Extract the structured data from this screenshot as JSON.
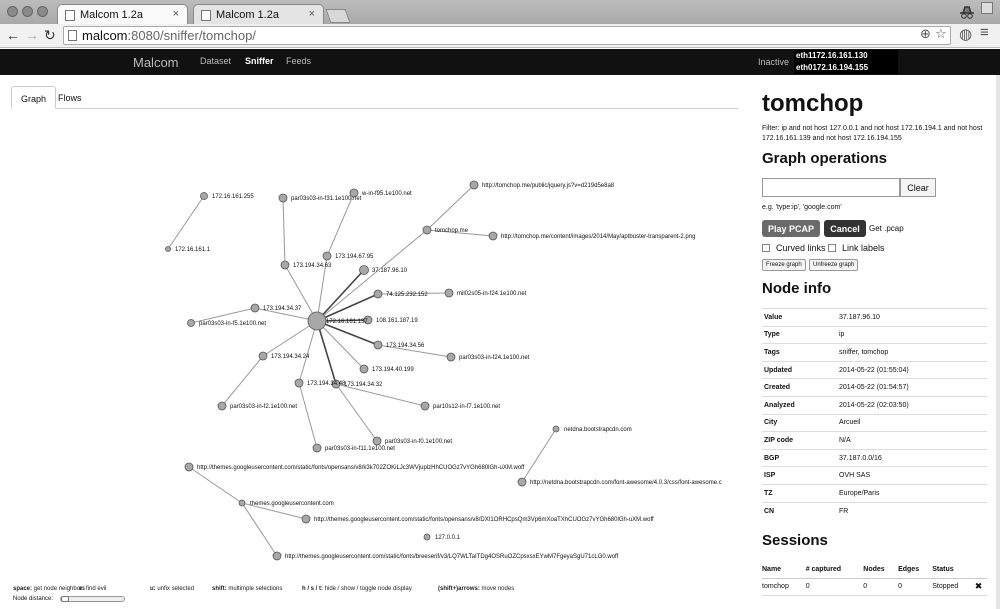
{
  "browser": {
    "tabs": [
      {
        "title": "Malcom 1.2a",
        "close": "×"
      },
      {
        "title": "Malcom 1.2a",
        "close": "×"
      }
    ],
    "url_host": "malcom",
    "url_rest": ":8080/sniffer/tomchop/",
    "icons": {
      "back": "←",
      "forward": "→",
      "reload": "↻",
      "zoom": "⊕",
      "star": "☆",
      "globe": "◍",
      "menu": "≡"
    }
  },
  "app": {
    "brand": "Malcom",
    "nav": [
      "Dataset",
      "Sniffer",
      "Feeds"
    ],
    "status": "Inactive",
    "interfaces": [
      "eth1172.16.161.130",
      "eth0172.16.194.155"
    ]
  },
  "left_tabs": [
    "Graph",
    "Flows"
  ],
  "graph": {
    "hub": "172.16.161.137",
    "nodes": [
      "172.16.161.255",
      "172.16.161.1",
      "par03s03-in-f31.1e100.net",
      "w-in-f95.1e100.net",
      "http://tomchop.me/public/jquery.js?v=d219d5e8a8",
      "tomchop.me",
      "http://tomchop.me/content/images/2014/May/aptbuster-transparent-2.png",
      "173.194.67.95",
      "173.194.34.63",
      "37.187.96.10",
      "74.125.232.152",
      "mil02s05-in-f24.1e100.net",
      "108.161.187.19",
      "173.194.34.37",
      "par03s03-in-f5.1e100.net",
      "173.194.34.56",
      "173.194.34.24",
      "par03s03-in-f24.1e100.net",
      "173.194.40.199",
      "173.194.34.48",
      "173.194.34.32",
      "par03s03-in-f2.1e100.net",
      "par10s12-in-f7.1e100.net",
      "par03s03-in-f0.1e100.net",
      "par03s03-in-f11.1e100.net",
      "netdna.bootstrapcdn.com",
      "http://themes.googleusercontent.com/static/fonts/opensans/v8/k3k702ZOKiLJc3WVjuplzHhCUOGz7vYGh680lGh-uXM.woff",
      "http://netdna.bootstrapcdn.com/font-awesome/4.0.3/css/font-awesome.c",
      "themes.googleusercontent.com",
      "http://themes.googleusercontent.com/static/fonts/opensans/v8/DXI1ORHCpsQm3Vp6mXoaTXhCUOGz7vYGh680lGh-uXM.woff",
      "127.0.0.1",
      "http://themes.googleusercontent.com/static/fonts/breeserif/v3/LQ7WLTaITDg4OSRuOZCpsxsxEYwM7FgeyaSgU71cLG0.woff"
    ]
  },
  "help": {
    "items": [
      {
        "key": "space:",
        "desc": " get node neighbors"
      },
      {
        "key": "e:",
        "desc": " find evil"
      },
      {
        "key": "u:",
        "desc": " unfix selected"
      },
      {
        "key": "shift:",
        "desc": " multimple selections"
      },
      {
        "key": "h / s / t:",
        "desc": " hide / show / toggle node display"
      },
      {
        "key": "(shift+)arrows:",
        "desc": " move nodes"
      }
    ],
    "node_distance": "Node distance:"
  },
  "panel": {
    "title": "tomchop",
    "filter": "Filter: ip and not host 127.0.0.1 and not host 172.16.194.1 and not host 172.16.161.139 and not host 172.16.194.155",
    "graph_ops_title": "Graph operations",
    "search_placeholder": "",
    "clear_label": "Clear",
    "hint": "e.g. 'type:ip', 'google.com'",
    "play_label": "Play PCAP",
    "cancel_label": "Cancel",
    "get_pcap": "Get .pcap",
    "curved_links": "Curved links",
    "link_labels": "Link labels",
    "freeze_label": "Freeze graph",
    "unfreeze_label": "Unfreeze graph",
    "node_info_title": "Node info",
    "node_info": [
      {
        "k": "Value",
        "v": "37.187.96.10"
      },
      {
        "k": "Type",
        "v": "ip"
      },
      {
        "k": "Tags",
        "v": "sniffer, tomchop"
      },
      {
        "k": "Updated",
        "v": "2014-05-22 (01:55:04)"
      },
      {
        "k": "Created",
        "v": "2014-05-22 (01:54:57)"
      },
      {
        "k": "Analyzed",
        "v": "2014-05-22 (02:03:50)"
      },
      {
        "k": "City",
        "v": "Arcueil"
      },
      {
        "k": "ZIP code",
        "v": "N/A"
      },
      {
        "k": "BGP",
        "v": "37.187.0.0/16"
      },
      {
        "k": "ISP",
        "v": "OVH SAS"
      },
      {
        "k": "TZ",
        "v": "Europe/Paris"
      },
      {
        "k": "CN",
        "v": "FR"
      }
    ],
    "sessions_title": "Sessions",
    "session_headers": [
      "Name",
      "# captured",
      "Nodes",
      "Edges",
      "Status"
    ],
    "sessions": [
      {
        "name": "tomchop",
        "captured": "0",
        "nodes": "0",
        "edges": "0",
        "status": "Stopped",
        "delete": "✖"
      }
    ]
  }
}
